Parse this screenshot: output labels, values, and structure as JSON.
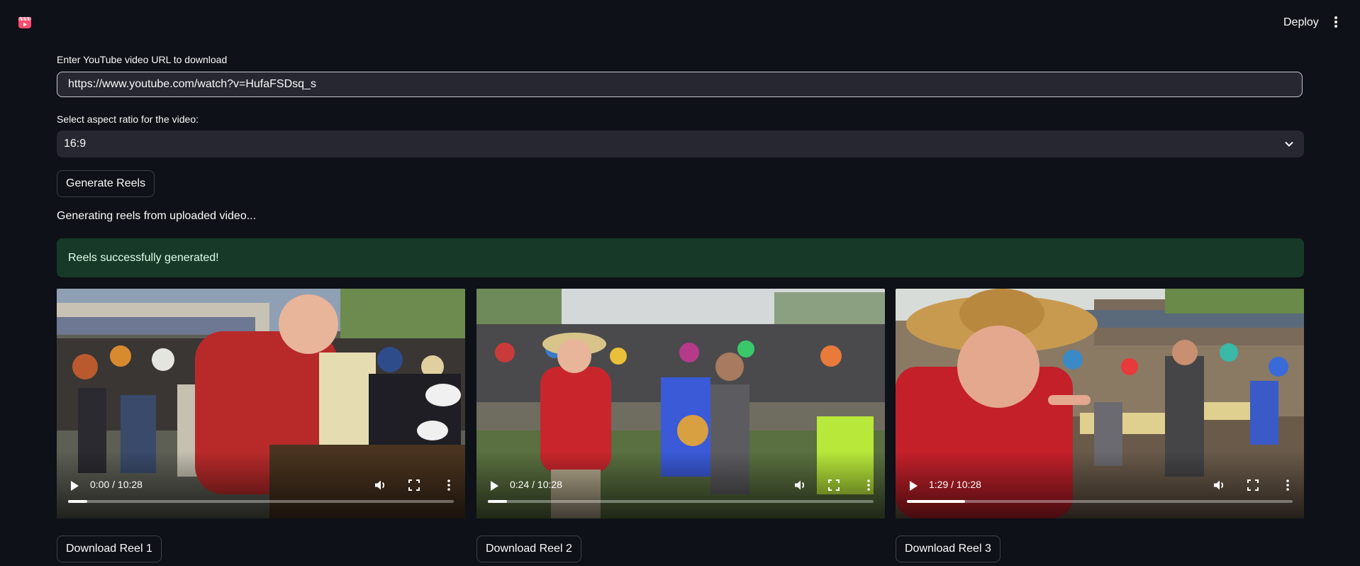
{
  "header": {
    "deploy_label": "Deploy"
  },
  "form": {
    "url_label": "Enter YouTube video URL to download",
    "url_value": "https://www.youtube.com/watch?v=HufaFSDsq_s",
    "aspect_label": "Select aspect ratio for the video:",
    "aspect_value": "16:9",
    "generate_label": "Generate Reels"
  },
  "status": {
    "generating": "Generating reels from uploaded video...",
    "success": "Reels successfully generated!"
  },
  "reels": [
    {
      "time": "0:00 / 10:28",
      "progress": 0.05,
      "download_label": "Download Reel 1"
    },
    {
      "time": "0:24 / 10:28",
      "progress": 0.05,
      "download_label": "Download Reel 2"
    },
    {
      "time": "1:29 / 10:28",
      "progress": 0.15,
      "download_label": "Download Reel 3"
    }
  ],
  "colors": {
    "background": "#0e1117",
    "input_bg": "#262730",
    "success_bg": "#173928",
    "success_text": "#dffde9"
  },
  "icons": [
    "streamlit-reels-logo",
    "kebab-menu-icon",
    "chevron-down-icon",
    "play-icon",
    "volume-icon",
    "fullscreen-icon",
    "more-options-icon"
  ]
}
